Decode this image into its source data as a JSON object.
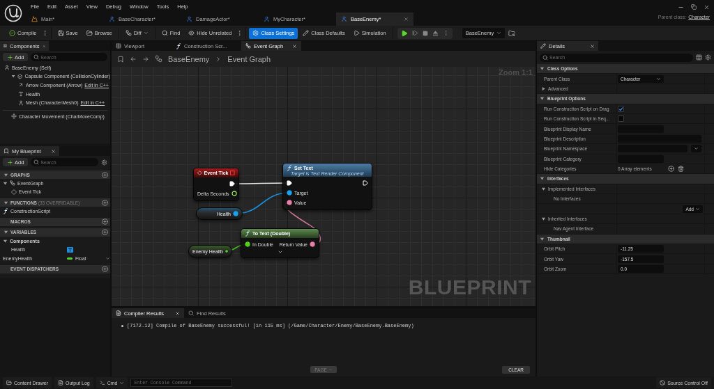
{
  "menu": [
    "File",
    "Edit",
    "Asset",
    "View",
    "Debug",
    "Window",
    "Tools",
    "Help"
  ],
  "document_tabs": [
    {
      "label": "Main*",
      "kind": "level",
      "selected": false
    },
    {
      "label": "BaseCharacter*",
      "kind": "blueprint",
      "selected": false
    },
    {
      "label": "DamageActor*",
      "kind": "blueprint",
      "selected": false
    },
    {
      "label": "MyCharacter*",
      "kind": "blueprint",
      "selected": false
    },
    {
      "label": "BaseEnemy*",
      "kind": "blueprint",
      "selected": true
    }
  ],
  "parent_class": {
    "label": "Parent class:",
    "value": "Character"
  },
  "toolbar_groups": [
    {
      "items": [
        {
          "label": "Compile",
          "kind": "button",
          "has_menu": true,
          "selected": false
        }
      ]
    },
    {
      "items": [
        {
          "label": "Save",
          "kind": "button",
          "selected": false
        },
        {
          "label": "Browse",
          "kind": "button",
          "selected": false
        }
      ]
    },
    {
      "items": [
        {
          "label": "Diff",
          "kind": "dropdown",
          "selected": false
        }
      ]
    },
    {
      "items": [
        {
          "label": "Find",
          "kind": "button",
          "selected": false
        },
        {
          "label": "Hide Unrelated",
          "kind": "button",
          "has_menu": true,
          "selected": false
        }
      ]
    },
    {
      "items": [
        {
          "label": "Class Settings",
          "kind": "button",
          "selected": true
        },
        {
          "label": "Class Defaults",
          "kind": "button",
          "selected": false
        },
        {
          "label": "Simulation",
          "kind": "button",
          "selected": false
        }
      ]
    }
  ],
  "debug_object": "BaseEnemy",
  "components": {
    "title": "Components",
    "add": "Add",
    "search_placeholder": "Search",
    "tree": [
      {
        "label": "BaseEnemy (Self)",
        "kind": "actor",
        "children": [
          {
            "label": "Capsule Component (CollisionCylinder)",
            "kind": "capsule",
            "expanded": true,
            "children": [
              {
                "label": "Arrow Component (Arrow)",
                "kind": "arrow",
                "link": "Edit in C++"
              },
              {
                "label": "Health",
                "kind": "text_render"
              },
              {
                "label": "Mesh (CharacterMesh0)",
                "kind": "mesh",
                "link": "Edit in C++"
              }
            ]
          }
        ]
      }
    ],
    "non_scene": [
      {
        "label": "Character Movement (CharMoveComp)",
        "kind": "movement"
      }
    ]
  },
  "my_blueprint": {
    "title": "My Blueprint",
    "add": "Add",
    "search_placeholder": "Search",
    "sections": [
      {
        "title": "GRAPHS",
        "expanded": true,
        "items": [
          {
            "label": "EventGraph",
            "kind": "graph",
            "expanded": true,
            "children": [
              {
                "label": "Event Tick",
                "kind": "event"
              }
            ]
          }
        ]
      },
      {
        "title": "FUNCTIONS",
        "note": "(33 OVERRIDABLE)",
        "expanded": true,
        "items": [
          {
            "label": "ConstructionScript",
            "kind": "function"
          }
        ]
      },
      {
        "title": "MACROS",
        "expanded": false
      },
      {
        "title": "VARIABLES",
        "expanded": true,
        "items": [
          {
            "label": "Components",
            "kind": "group",
            "expanded": true,
            "children": [
              {
                "label": "Health",
                "kind": "component_variable",
                "color": "#1d8fe0"
              }
            ]
          },
          {
            "label": "EnemyHealth",
            "kind": "float_variable",
            "type_label": "Float",
            "color": "#53d62b"
          }
        ]
      },
      {
        "title": "EVENT DISPATCHERS",
        "expanded": false
      }
    ]
  },
  "graph_tabs": [
    {
      "label": "Viewport",
      "kind": "viewport",
      "selected": false
    },
    {
      "label": "Construction Scr...",
      "kind": "function",
      "selected": false
    },
    {
      "label": "Event Graph",
      "kind": "graph",
      "selected": true
    }
  ],
  "breadcrumb": [
    "BaseEnemy",
    "Event Graph"
  ],
  "zoom": "Zoom 1:1",
  "watermark": "BLUEPRINT",
  "nodes": [
    {
      "kind": "event",
      "title": "Event Tick",
      "outputs": [
        {
          "kind": "exec",
          "connected": true
        },
        {
          "kind": "float",
          "label": "Delta Seconds",
          "connected": false
        }
      ]
    },
    {
      "kind": "function",
      "title": "Set Text",
      "subtitle": "Target is Text Render Component",
      "inputs": [
        {
          "kind": "exec",
          "connected": true
        },
        {
          "kind": "object",
          "label": "Target",
          "connected": true
        },
        {
          "kind": "text",
          "label": "Value",
          "connected": true
        }
      ],
      "outputs": [
        {
          "kind": "exec",
          "connected": false
        }
      ]
    },
    {
      "kind": "variable",
      "title": "Health",
      "outputs": [
        {
          "kind": "object",
          "connected": true
        }
      ]
    },
    {
      "kind": "pure_function",
      "title": "To Text (Double)",
      "inputs": [
        {
          "kind": "double",
          "label": "In Double",
          "connected": true
        }
      ],
      "outputs": [
        {
          "kind": "text",
          "label": "Return Value",
          "connected": true
        }
      ],
      "advanced_hidden": true
    },
    {
      "kind": "variable",
      "title": "Enemy Health",
      "outputs": [
        {
          "kind": "double",
          "connected": true
        }
      ]
    }
  ],
  "compiler": {
    "tabs": [
      {
        "label": "Compiler Results",
        "kind": "results",
        "selected": true
      },
      {
        "label": "Find Results",
        "kind": "find",
        "selected": false
      }
    ],
    "messages": [
      "[7172.12] Compile of BaseEnemy successful! [in 115 ms] (/Game/Character/Enemy/BaseEnemy.BaseEnemy)"
    ],
    "page": {
      "label": "PAGE",
      "disabled": true
    },
    "clear": "CLEAR"
  },
  "details": {
    "title": "Details",
    "search_placeholder": "Search",
    "sections": [
      {
        "title": "Class Options",
        "expanded": true,
        "rows": [
          {
            "kind": "dropdown",
            "label": "Parent Class",
            "value": "Character"
          },
          {
            "kind": "group",
            "label": "Advanced",
            "expanded": false
          }
        ]
      },
      {
        "title": "Blueprint Options",
        "expanded": true,
        "rows": [
          {
            "kind": "checkbox",
            "label": "Run Construction Script on Drag",
            "checked": true
          },
          {
            "kind": "checkbox",
            "label": "Run Construction Script in Seq...",
            "checked": false
          },
          {
            "kind": "text",
            "label": "Blueprint Display Name"
          },
          {
            "kind": "text_wide",
            "label": "Blueprint Description"
          },
          {
            "kind": "combo",
            "label": "Blueprint Namespace"
          },
          {
            "kind": "text",
            "label": "Blueprint Category"
          },
          {
            "kind": "array",
            "label": "Hide Categories",
            "value": "0 Array elements"
          }
        ]
      },
      {
        "title": "Interfaces",
        "expanded": true,
        "rows": [
          {
            "kind": "group",
            "label": "Implemented Interfaces",
            "expanded": true
          },
          {
            "kind": "note",
            "label": "No Interfaces"
          },
          {
            "kind": "add",
            "label": "Add"
          },
          {
            "kind": "group",
            "label": "Inherited Interfaces",
            "expanded": true
          },
          {
            "kind": "note",
            "label": "Nav Agent Interface"
          }
        ]
      },
      {
        "title": "Thumbnail",
        "expanded": true,
        "rows": [
          {
            "kind": "text",
            "label": "Orbit Pitch",
            "value": "-11.25"
          },
          {
            "kind": "text",
            "label": "Orbit Yaw",
            "value": "-157.5"
          },
          {
            "kind": "text",
            "label": "Orbit Zoom",
            "value": "0.0"
          }
        ]
      }
    ]
  },
  "status_bar": {
    "content_drawer": "Content Drawer",
    "output_log": "Output Log",
    "cmd": "Cmd",
    "console_placeholder": "Enter Console Command",
    "source_control": "Source Control Off"
  }
}
